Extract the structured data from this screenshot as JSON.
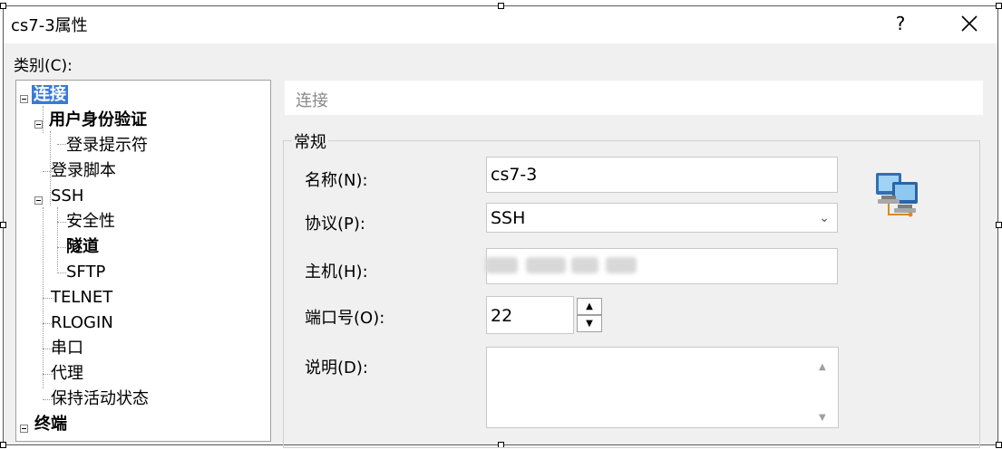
{
  "window": {
    "title": "cs7-3属性",
    "help_label": "?",
    "close_label": "✕"
  },
  "category": {
    "label": "类别(C):",
    "tree": [
      {
        "label": "连接"
      },
      {
        "label": "用户身份验证"
      },
      {
        "label": "登录提示符"
      },
      {
        "label": "登录脚本"
      },
      {
        "label": "SSH"
      },
      {
        "label": "安全性"
      },
      {
        "label": "隧道"
      },
      {
        "label": "SFTP"
      },
      {
        "label": "TELNET"
      },
      {
        "label": "RLOGIN"
      },
      {
        "label": "串口"
      },
      {
        "label": "代理"
      },
      {
        "label": "保持活动状态"
      },
      {
        "label": "终端"
      }
    ]
  },
  "main": {
    "section_title": "连接",
    "group_title": "常规",
    "fields": {
      "name_label": "名称(N):",
      "name_value": "cs7-3",
      "protocol_label": "协议(P):",
      "protocol_value": "SSH",
      "host_label": "主机(H):",
      "host_value": "",
      "port_label": "端口号(O):",
      "port_value": "22",
      "desc_label": "说明(D):",
      "desc_value": ""
    },
    "icon": "network-computers-icon"
  },
  "colors": {
    "selection": "#3a7ad6",
    "dialog_bg": "#f0f0f0"
  }
}
